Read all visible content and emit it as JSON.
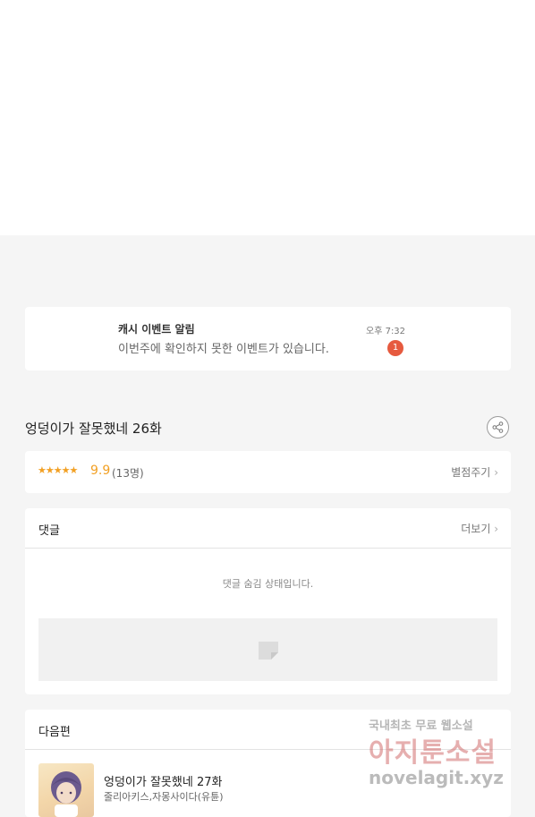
{
  "notification": {
    "title": "캐시 이벤트 알림",
    "message": "이번주에 확인하지 못한 이벤트가 있습니다.",
    "time": "오후 7:32",
    "badge": "1"
  },
  "episode": {
    "title": "엉덩이가 잘못했네 26화",
    "share_icon": "share-icon"
  },
  "rating": {
    "stars": "★★★★★",
    "score": "9.9",
    "count": "(13명)",
    "rate_label": "별점주기",
    "accent": "#f2a023"
  },
  "comments": {
    "label": "댓글",
    "more": "더보기",
    "hidden_message": "댓글 숨김 상태입니다."
  },
  "next_episode": {
    "label": "다음편",
    "title": "엉덩이가 잘못했네 27화",
    "authors": "줄리아키스,자몽사이다(유튠)"
  },
  "watermark": {
    "line1": "국내최초 무료 웹소설",
    "line2": "아지툰소설",
    "line3": "novelagit.xyz"
  },
  "colors": {
    "badge": "#e65a3f",
    "background": "#f5f5f5"
  }
}
